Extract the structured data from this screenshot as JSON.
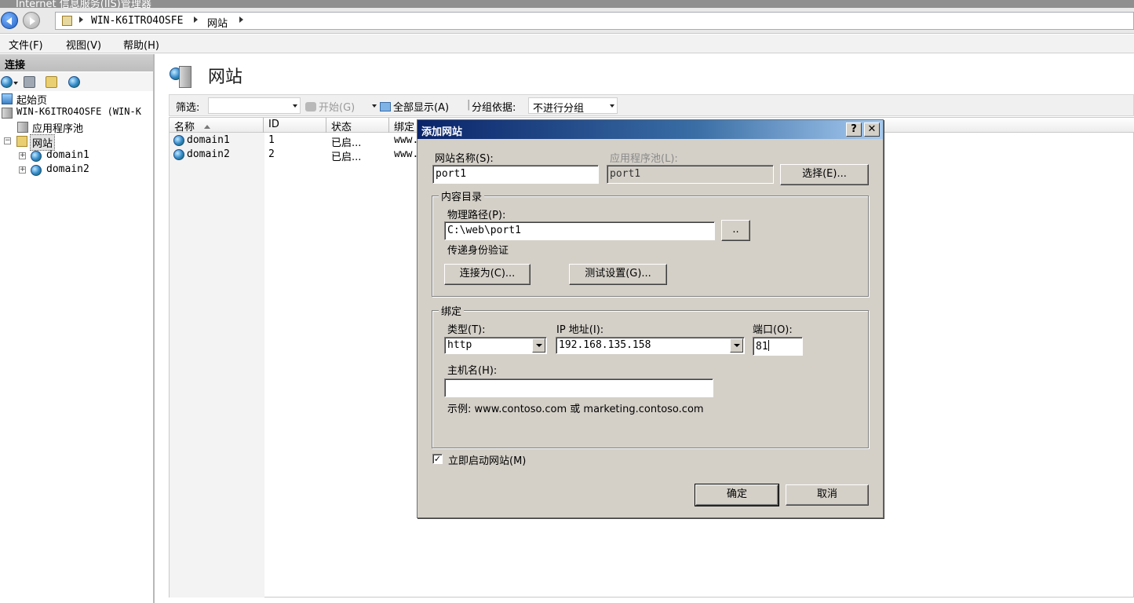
{
  "window": {
    "title": "Internet 信息服务(IIS)管理器"
  },
  "address": {
    "crumbs": [
      "WIN-K6ITRO4OSFE",
      "网站"
    ]
  },
  "menu": [
    "文件(F)",
    "视图(V)",
    "帮助(H)"
  ],
  "connections": {
    "header": "连接",
    "tree": {
      "start_page": "起始页",
      "server": "WIN-K6ITRO4OSFE (WIN-K",
      "app_pools": "应用程序池",
      "sites": "网站",
      "site_items": [
        "domain1",
        "domain2"
      ]
    }
  },
  "main": {
    "title": "网站",
    "filter": {
      "label": "筛选:",
      "start": "开始(G)",
      "show_all": "全部显示(A)",
      "group_by_label": "分组依据:",
      "group_by_value": "不进行分组"
    },
    "grid": {
      "columns": [
        "名称",
        "ID",
        "状态",
        "绑定"
      ],
      "rows": [
        {
          "name": "domain1",
          "id": "1",
          "status": "已启...",
          "binding": "www."
        },
        {
          "name": "domain2",
          "id": "2",
          "status": "已启...",
          "binding": "www."
        }
      ]
    }
  },
  "dialog": {
    "title": "添加网站",
    "site_name_label": "网站名称(S):",
    "site_name_value": "port1",
    "app_pool_label": "应用程序池(L):",
    "app_pool_value": "port1",
    "select_button": "选择(E)...",
    "content_dir": {
      "legend": "内容目录",
      "physical_path_label": "物理路径(P):",
      "physical_path_value": "C:\\web\\port1",
      "browse_button": "..",
      "passthrough_label": "传递身份验证",
      "connect_as_button": "连接为(C)...",
      "test_settings_button": "测试设置(G)..."
    },
    "binding": {
      "legend": "绑定",
      "type_label": "类型(T):",
      "type_value": "http",
      "ip_label": "IP 地址(I):",
      "ip_value": "192.168.135.158",
      "port_label": "端口(O):",
      "port_value": "81",
      "host_label": "主机名(H):",
      "host_value": "",
      "example": "示例: www.contoso.com 或 marketing.contoso.com"
    },
    "start_now_label": "立即启动网站(M)",
    "start_now_checked": true,
    "ok_button": "确定",
    "cancel_button": "取消"
  }
}
